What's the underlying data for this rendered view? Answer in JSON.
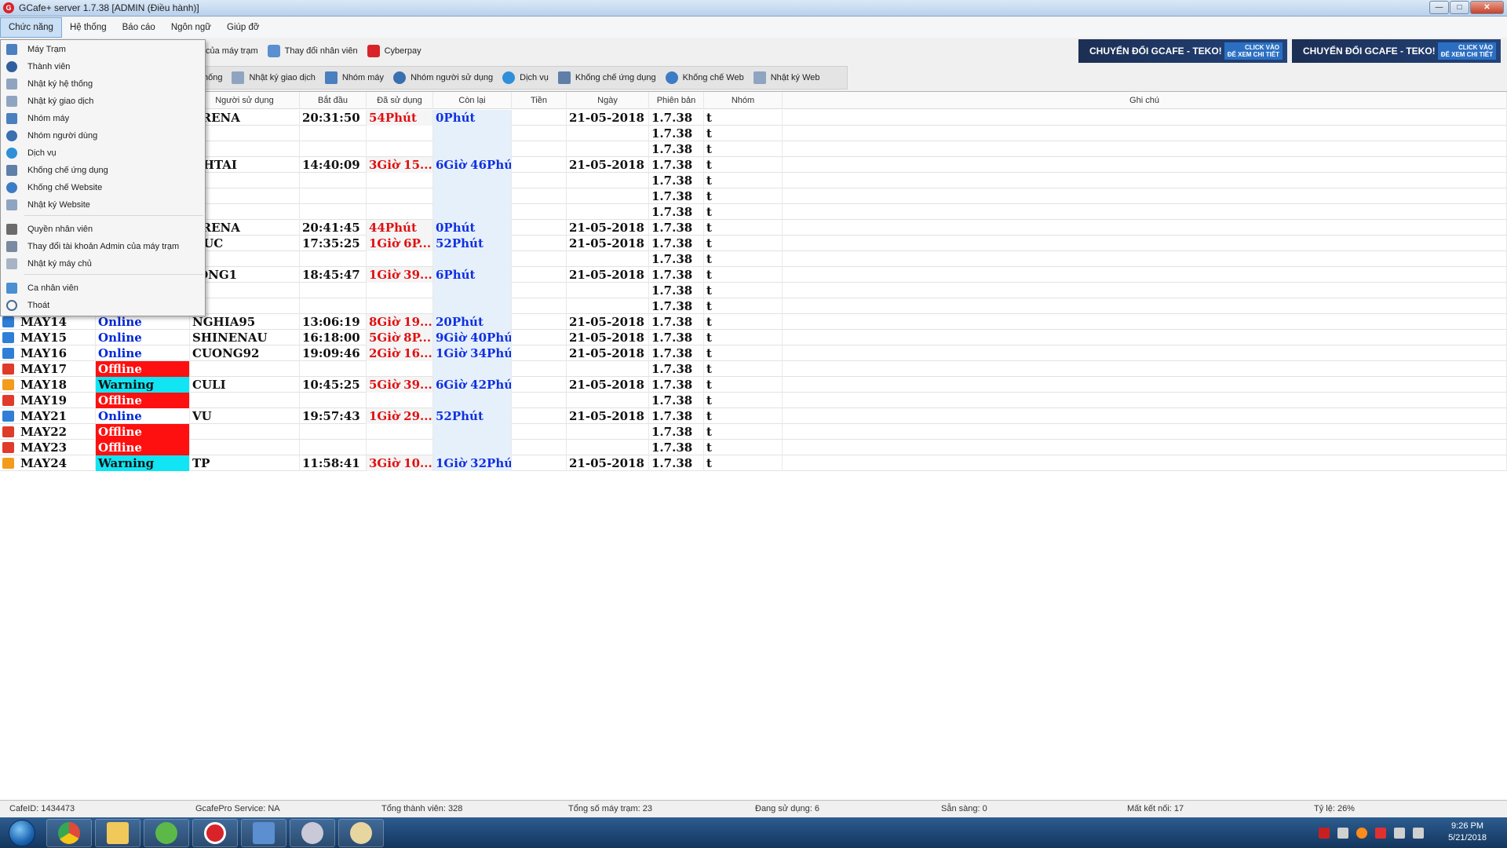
{
  "window": {
    "title": "GCafe+ server 1.7.38 [ADMIN (Điều hành)]",
    "minimize": "—",
    "maximize": "□",
    "close": "✕"
  },
  "menubar": {
    "items": [
      "Chức năng",
      "Hệ thống",
      "Báo cáo",
      "Ngôn ngữ",
      "Giúp đỡ"
    ]
  },
  "toolbar1": {
    "items": [
      "của máy trạm",
      "Thay đổi nhân viên",
      "Cyberpay"
    ]
  },
  "toolbar2": {
    "items": [
      "hống",
      "Nhật ký giao dịch",
      "Nhóm máy",
      "Nhóm người sử dụng",
      "Dịch vụ",
      "Khống chế ứng dụng",
      "Khống chế Web",
      "Nhật ký Web"
    ]
  },
  "banner": {
    "text": "CHUYỂN ĐỔI GCAFE - TEKO!",
    "cta_line1": "CLICK VÀO",
    "cta_line2": "ĐỂ XEM CHI TIẾT"
  },
  "grid": {
    "columns": [
      "Người sử dụng",
      "Bắt đầu",
      "Đã sử dụng",
      "Còn lại",
      "Tiền",
      "Ngày",
      "Phiên bản",
      "Nhóm",
      "Ghi chú"
    ],
    "rows": [
      {
        "name": "",
        "status": "",
        "user": "ARENA",
        "start": "20:31:50",
        "used": "54Phút",
        "left": "0Phút",
        "money": "",
        "date": "21-05-2018",
        "version": "1.7.38",
        "group": "t"
      },
      {
        "name": "",
        "status": "",
        "user": "",
        "start": "",
        "used": "",
        "left": "",
        "money": "",
        "date": "",
        "version": "1.7.38",
        "group": "t"
      },
      {
        "name": "",
        "status": "",
        "user": "",
        "start": "",
        "used": "",
        "left": "",
        "money": "",
        "date": "",
        "version": "1.7.38",
        "group": "t"
      },
      {
        "name": "",
        "status": "",
        "user": "NHTAI",
        "start": "14:40:09",
        "used": "3Giờ 15...",
        "left": "6Giờ 46Phút",
        "money": "",
        "date": "21-05-2018",
        "version": "1.7.38",
        "group": "t"
      },
      {
        "name": "",
        "status": "",
        "user": "",
        "start": "",
        "used": "",
        "left": "",
        "money": "",
        "date": "",
        "version": "1.7.38",
        "group": "t"
      },
      {
        "name": "",
        "status": "",
        "user": "",
        "start": "",
        "used": "",
        "left": "",
        "money": "",
        "date": "",
        "version": "1.7.38",
        "group": "t"
      },
      {
        "name": "",
        "status": "",
        "user": "",
        "start": "",
        "used": "",
        "left": "",
        "money": "",
        "date": "",
        "version": "1.7.38",
        "group": "t"
      },
      {
        "name": "",
        "status": "",
        "user": "ARENA",
        "start": "20:41:45",
        "used": "44Phút",
        "left": "0Phút",
        "money": "",
        "date": "21-05-2018",
        "version": "1.7.38",
        "group": "t"
      },
      {
        "name": "",
        "status": "",
        "user": "HUC",
        "start": "17:35:25",
        "used": "1Giờ 6P...",
        "left": "52Phút",
        "money": "",
        "date": "21-05-2018",
        "version": "1.7.38",
        "group": "t"
      },
      {
        "name": "",
        "status": "",
        "user": "",
        "start": "",
        "used": "",
        "left": "",
        "money": "",
        "date": "",
        "version": "1.7.38",
        "group": "t"
      },
      {
        "name": "",
        "status": "",
        "user": "JONG1",
        "start": "18:45:47",
        "used": "1Giờ 39...",
        "left": "6Phút",
        "money": "",
        "date": "21-05-2018",
        "version": "1.7.38",
        "group": "t"
      },
      {
        "name": "",
        "status": "",
        "user": "",
        "start": "",
        "used": "",
        "left": "",
        "money": "",
        "date": "",
        "version": "1.7.38",
        "group": "t"
      },
      {
        "name": "",
        "status": "",
        "user": "",
        "start": "",
        "used": "",
        "left": "",
        "money": "",
        "date": "",
        "version": "1.7.38",
        "group": "t"
      },
      {
        "name": "MAY14",
        "status": "Online",
        "user": "NGHIA95",
        "start": "13:06:19",
        "used": "8Giờ 19...",
        "left": "20Phút",
        "money": "",
        "date": "21-05-2018",
        "version": "1.7.38",
        "group": "t"
      },
      {
        "name": "MAY15",
        "status": "Online",
        "user": "SHINENAU",
        "start": "16:18:00",
        "used": "5Giờ 8P...",
        "left": "9Giờ 40Phút",
        "money": "",
        "date": "21-05-2018",
        "version": "1.7.38",
        "group": "t"
      },
      {
        "name": "MAY16",
        "status": "Online",
        "user": "CUONG92",
        "start": "19:09:46",
        "used": "2Giờ 16...",
        "left": "1Giờ 34Phút",
        "money": "",
        "date": "21-05-2018",
        "version": "1.7.38",
        "group": "t"
      },
      {
        "name": "MAY17",
        "status": "Offline",
        "user": "",
        "start": "",
        "used": "",
        "left": "",
        "money": "",
        "date": "",
        "version": "1.7.38",
        "group": "t"
      },
      {
        "name": "MAY18",
        "status": "Warning",
        "user": "CULI",
        "start": "10:45:25",
        "used": "5Giờ 39...",
        "left": "6Giờ 42Phút",
        "money": "",
        "date": "21-05-2018",
        "version": "1.7.38",
        "group": "t"
      },
      {
        "name": "MAY19",
        "status": "Offline",
        "user": "",
        "start": "",
        "used": "",
        "left": "",
        "money": "",
        "date": "",
        "version": "1.7.38",
        "group": "t"
      },
      {
        "name": "MAY21",
        "status": "Online",
        "user": "VU",
        "start": "19:57:43",
        "used": "1Giờ 29...",
        "left": "52Phút",
        "money": "",
        "date": "21-05-2018",
        "version": "1.7.38",
        "group": "t"
      },
      {
        "name": "MAY22",
        "status": "Offline",
        "user": "",
        "start": "",
        "used": "",
        "left": "",
        "money": "",
        "date": "",
        "version": "1.7.38",
        "group": "t"
      },
      {
        "name": "MAY23",
        "status": "Offline",
        "user": "",
        "start": "",
        "used": "",
        "left": "",
        "money": "",
        "date": "",
        "version": "1.7.38",
        "group": "t"
      },
      {
        "name": "MAY24",
        "status": "Warning",
        "user": "TP",
        "start": "11:58:41",
        "used": "3Giờ 10...",
        "left": "1Giờ 32Phút",
        "money": "",
        "date": "21-05-2018",
        "version": "1.7.38",
        "group": "t"
      }
    ]
  },
  "dropdown": {
    "items": [
      "Máy Trạm",
      "Thành viên",
      "Nhật ký hệ thống",
      "Nhật ký giao dịch",
      "Nhóm máy",
      "Nhóm người dùng",
      "Dịch vụ",
      "Khống chế ứng dụng",
      "Khống chế Website",
      "Nhật ký Website",
      "Quyền nhân viên",
      "Thay đổi tài khoản Admin của máy trạm",
      "Nhật ký máy chủ",
      "Ca nhân viên",
      "Thoát"
    ]
  },
  "statusbar": {
    "cafe_id": "CafeID: 1434473",
    "service": "GcafePro Service: NA",
    "members": "Tổng thành viên: 328",
    "stations": "Tổng số máy trạm: 23",
    "in_use": "Đang sử dụng: 6",
    "ready": "Sẵn sàng: 0",
    "lost": "Mất kết nối: 17",
    "ratio": "Tỷ lệ: 26%"
  },
  "taskbar": {
    "time": "9:26 PM",
    "date": "5/21/2018"
  },
  "colors": {
    "online": "#0028d8",
    "offline": "#ff1010",
    "warning": "#11e4f2",
    "used": "#e01010",
    "left": "#1030e0"
  }
}
